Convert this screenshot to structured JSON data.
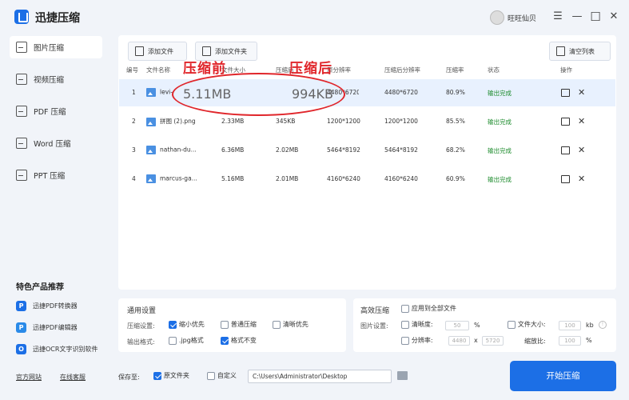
{
  "app": {
    "title": "迅捷压缩",
    "username": "旺旺仙贝"
  },
  "window": {
    "menu": "☰",
    "minimize": "—",
    "maximize": "☐",
    "close": "✕"
  },
  "sidebar": {
    "items": [
      {
        "label": "图片压缩",
        "active": true
      },
      {
        "label": "视频压缩",
        "active": false
      },
      {
        "label": "PDF 压缩",
        "active": false
      },
      {
        "label": "Word 压缩",
        "active": false
      },
      {
        "label": "PPT 压缩",
        "active": false
      }
    ],
    "featured_title": "特色产品推荐",
    "featured": [
      {
        "label": "迅捷PDF转换器",
        "color": "#1c6fe6",
        "icon": "P"
      },
      {
        "label": "迅捷PDF编辑器",
        "color": "#2a8ae8",
        "icon": "P"
      },
      {
        "label": "迅捷OCR文字识别软件",
        "color": "#1c6fe6",
        "icon": "O"
      }
    ],
    "footer": {
      "website": "官方网站",
      "support": "在线客服"
    }
  },
  "toolbar": {
    "add_file": "添加文件",
    "add_folder": "添加文件夹",
    "clear": "清空列表"
  },
  "table": {
    "headers": [
      "编号",
      "文件名称",
      "文件大小",
      "压缩后",
      "原分辨率",
      "压缩后分辨率",
      "压缩率",
      "状态",
      "操作"
    ],
    "rows": [
      {
        "no": "1",
        "name": "levi-",
        "size": "5.11MB",
        "compressed": "994KB",
        "res": "4480*6720",
        "new_res": "4480*6720",
        "rate": "80.9%",
        "status": "输出完成"
      },
      {
        "no": "2",
        "name": "拼图 (2).png",
        "size": "2.33MB",
        "compressed": "345KB",
        "res": "1200*1200",
        "new_res": "1200*1200",
        "rate": "85.5%",
        "status": "输出完成"
      },
      {
        "no": "3",
        "name": "nathan-du...",
        "size": "6.36MB",
        "compressed": "2.02MB",
        "res": "5464*8192",
        "new_res": "5464*8192",
        "rate": "68.2%",
        "status": "输出完成"
      },
      {
        "no": "4",
        "name": "marcus-ga...",
        "size": "5.16MB",
        "compressed": "2.01MB",
        "res": "4160*6240",
        "new_res": "4160*6240",
        "rate": "60.9%",
        "status": "输出完成"
      }
    ]
  },
  "annotation": {
    "before_label": "压缩前",
    "after_label": "压缩后",
    "before_value": "5.11MB",
    "after_value": "994KB",
    "color": "#e0262b"
  },
  "general": {
    "title": "通用设置",
    "compress_label": "压缩设置:",
    "options": [
      {
        "label": "缩小优先",
        "checked": true
      },
      {
        "label": "普通压缩",
        "checked": false
      },
      {
        "label": "清晰优先",
        "checked": false
      }
    ],
    "format_label": "输出格式:",
    "formats": [
      {
        "label": ".jpg格式",
        "checked": false
      },
      {
        "label": "格式不变",
        "checked": true
      }
    ]
  },
  "efficient": {
    "title": "高效压缩",
    "apply_all": "应用到全部文件",
    "image_label": "图片设置:",
    "clarity_label": "清晰度:",
    "clarity_value": "50",
    "clarity_unit": "%",
    "filesize_label": "文件大小:",
    "filesize_value": "100",
    "filesize_unit": "kb",
    "resolution_label": "分辨率:",
    "res_w": "4480",
    "res_x": "x",
    "res_h": "5720",
    "scale_label": "缩放比:",
    "scale_value": "100",
    "scale_unit": "%"
  },
  "save": {
    "label": "保存至:",
    "source_folder": "原文件夹",
    "custom": "自定义",
    "path": "C:\\Users\\Administrator\\Desktop"
  },
  "start_button": "开始压缩",
  "colors": {
    "accent": "#1c6fe6",
    "success": "#1a8a2a",
    "selected_row": "#e8f1fe"
  }
}
